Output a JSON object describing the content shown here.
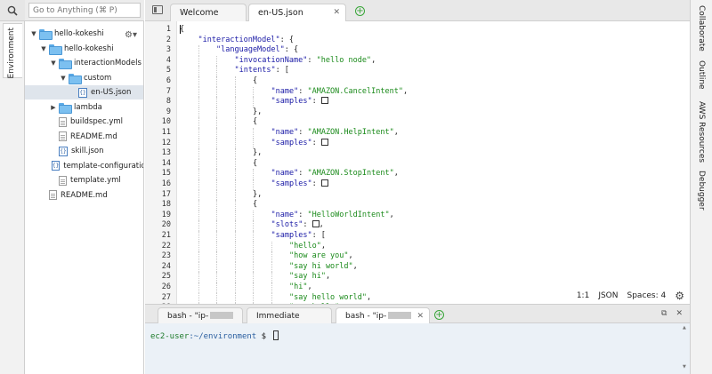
{
  "search": {
    "placeholder": "Go to Anything (⌘ P)"
  },
  "left_rail": {
    "environment_label": "Environment"
  },
  "tree": [
    {
      "label": "hello-kokeshi",
      "type": "folder",
      "open": true,
      "depth": 0,
      "gear": true
    },
    {
      "label": "hello-kokeshi",
      "type": "folder",
      "open": true,
      "depth": 1
    },
    {
      "label": "interactionModels",
      "type": "folder",
      "open": true,
      "depth": 2
    },
    {
      "label": "custom",
      "type": "folder",
      "open": true,
      "depth": 3
    },
    {
      "label": "en-US.json",
      "type": "json",
      "depth": 4,
      "selected": true
    },
    {
      "label": "lambda",
      "type": "folder",
      "open": false,
      "depth": 2
    },
    {
      "label": "buildspec.yml",
      "type": "file",
      "depth": 2
    },
    {
      "label": "README.md",
      "type": "file",
      "depth": 2
    },
    {
      "label": "skill.json",
      "type": "json",
      "depth": 2
    },
    {
      "label": "template-configuration",
      "type": "json",
      "depth": 2
    },
    {
      "label": "template.yml",
      "type": "file",
      "depth": 2
    },
    {
      "label": "README.md",
      "type": "file",
      "depth": 1
    }
  ],
  "editor_tabs": [
    {
      "label": "Welcome",
      "active": false
    },
    {
      "label": "en-US.json",
      "active": true
    }
  ],
  "code": [
    {
      "n": "1",
      "indent": 0,
      "parts": [
        [
          "p",
          "{"
        ]
      ]
    },
    {
      "n": "2",
      "indent": 1,
      "parts": [
        [
          "k",
          "\"interactionModel\""
        ],
        [
          "p",
          ": {"
        ]
      ]
    },
    {
      "n": "3",
      "indent": 2,
      "parts": [
        [
          "k",
          "\"languageModel\""
        ],
        [
          "p",
          ": {"
        ]
      ]
    },
    {
      "n": "4",
      "indent": 3,
      "parts": [
        [
          "k",
          "\"invocationName\""
        ],
        [
          "p",
          ": "
        ],
        [
          "s",
          "\"hello node\""
        ],
        [
          "p",
          ","
        ]
      ]
    },
    {
      "n": "5",
      "indent": 3,
      "parts": [
        [
          "k",
          "\"intents\""
        ],
        [
          "p",
          ": ["
        ]
      ]
    },
    {
      "n": "6",
      "indent": 4,
      "parts": [
        [
          "p",
          "{"
        ]
      ]
    },
    {
      "n": "7",
      "indent": 5,
      "parts": [
        [
          "k",
          "\"name\""
        ],
        [
          "p",
          ": "
        ],
        [
          "s",
          "\"AMAZON.CancelIntent\""
        ],
        [
          "p",
          ","
        ]
      ]
    },
    {
      "n": "8",
      "indent": 5,
      "parts": [
        [
          "k",
          "\"samples\""
        ],
        [
          "p",
          ": "
        ],
        [
          "box",
          ""
        ]
      ]
    },
    {
      "n": "9",
      "indent": 4,
      "parts": [
        [
          "p",
          "},"
        ]
      ]
    },
    {
      "n": "10",
      "indent": 4,
      "parts": [
        [
          "p",
          "{"
        ]
      ]
    },
    {
      "n": "11",
      "indent": 5,
      "parts": [
        [
          "k",
          "\"name\""
        ],
        [
          "p",
          ": "
        ],
        [
          "s",
          "\"AMAZON.HelpIntent\""
        ],
        [
          "p",
          ","
        ]
      ]
    },
    {
      "n": "12",
      "indent": 5,
      "parts": [
        [
          "k",
          "\"samples\""
        ],
        [
          "p",
          ": "
        ],
        [
          "box",
          ""
        ]
      ]
    },
    {
      "n": "13",
      "indent": 4,
      "parts": [
        [
          "p",
          "},"
        ]
      ]
    },
    {
      "n": "14",
      "indent": 4,
      "parts": [
        [
          "p",
          "{"
        ]
      ]
    },
    {
      "n": "15",
      "indent": 5,
      "parts": [
        [
          "k",
          "\"name\""
        ],
        [
          "p",
          ": "
        ],
        [
          "s",
          "\"AMAZON.StopIntent\""
        ],
        [
          "p",
          ","
        ]
      ]
    },
    {
      "n": "16",
      "indent": 5,
      "parts": [
        [
          "k",
          "\"samples\""
        ],
        [
          "p",
          ": "
        ],
        [
          "box",
          ""
        ]
      ]
    },
    {
      "n": "17",
      "indent": 4,
      "parts": [
        [
          "p",
          "},"
        ]
      ]
    },
    {
      "n": "18",
      "indent": 4,
      "parts": [
        [
          "p",
          "{"
        ]
      ]
    },
    {
      "n": "19",
      "indent": 5,
      "parts": [
        [
          "k",
          "\"name\""
        ],
        [
          "p",
          ": "
        ],
        [
          "s",
          "\"HelloWorldIntent\""
        ],
        [
          "p",
          ","
        ]
      ]
    },
    {
      "n": "20",
      "indent": 5,
      "parts": [
        [
          "k",
          "\"slots\""
        ],
        [
          "p",
          ": "
        ],
        [
          "box",
          ""
        ],
        [
          "p",
          ","
        ]
      ]
    },
    {
      "n": "21",
      "indent": 5,
      "parts": [
        [
          "k",
          "\"samples\""
        ],
        [
          "p",
          ": ["
        ]
      ]
    },
    {
      "n": "22",
      "indent": 6,
      "parts": [
        [
          "s",
          "\"hello\""
        ],
        [
          "p",
          ","
        ]
      ]
    },
    {
      "n": "23",
      "indent": 6,
      "parts": [
        [
          "s",
          "\"how are you\""
        ],
        [
          "p",
          ","
        ]
      ]
    },
    {
      "n": "24",
      "indent": 6,
      "parts": [
        [
          "s",
          "\"say hi world\""
        ],
        [
          "p",
          ","
        ]
      ]
    },
    {
      "n": "25",
      "indent": 6,
      "parts": [
        [
          "s",
          "\"say hi\""
        ],
        [
          "p",
          ","
        ]
      ]
    },
    {
      "n": "26",
      "indent": 6,
      "parts": [
        [
          "s",
          "\"hi\""
        ],
        [
          "p",
          ","
        ]
      ]
    },
    {
      "n": "27",
      "indent": 6,
      "parts": [
        [
          "s",
          "\"say hello world\""
        ],
        [
          "p",
          ","
        ]
      ]
    },
    {
      "n": "28",
      "indent": 6,
      "parts": [
        [
          "s",
          "\"say hello\""
        ]
      ]
    }
  ],
  "status": {
    "position": "1:1",
    "mode": "JSON",
    "spaces": "Spaces: 4"
  },
  "terminal_tabs": [
    {
      "label": "bash - \"ip-",
      "blurred": true,
      "active": false
    },
    {
      "label": "Immediate",
      "blurred": false,
      "active": false
    },
    {
      "label": "bash - \"ip-",
      "blurred": true,
      "active": true
    }
  ],
  "terminal": {
    "user": "ec2-user",
    "path": ":~/environment",
    "prompt": " $ "
  },
  "right_rail": [
    "Collaborate",
    "Outline",
    "AWS Resources",
    "Debugger"
  ],
  "colors": {
    "key": "#1a1aa6",
    "string": "#1a8a1a",
    "folder": "#7cc0f0",
    "terminal_bg": "#ebf1f7",
    "add_tab": "#3aa63a"
  }
}
